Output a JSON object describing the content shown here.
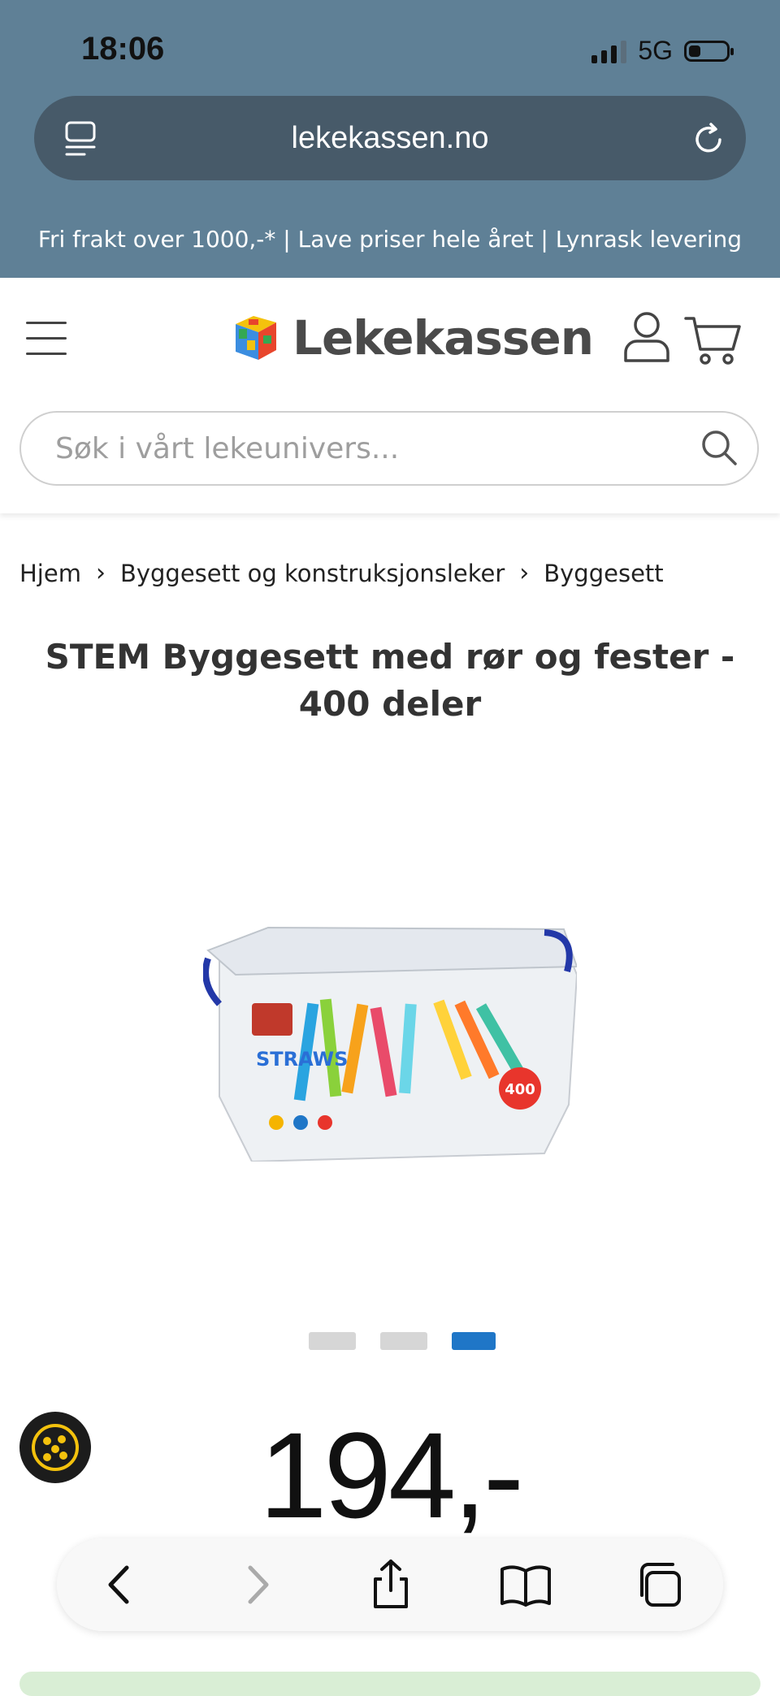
{
  "status_bar": {
    "time": "18:06",
    "network": "5G"
  },
  "browser": {
    "url": "lekekassen.no"
  },
  "promo": {
    "text": "Fri frakt over 1000,-* | Lave priser hele året | Lynrask levering"
  },
  "header": {
    "brand": "Lekekassen",
    "search_placeholder": "Søk i vårt lekeunivers..."
  },
  "breadcrumb": [
    "Hjem",
    "Byggesett og konstruksjonsleker",
    "Byggesett"
  ],
  "product": {
    "title": "STEM Byggesett med rør og fester - 400 deler",
    "box_label": "STRAWS",
    "badge": "400",
    "price": "194,-",
    "image_count": 3,
    "active_image": 3
  },
  "icons": {
    "tabs": "tabs-icon",
    "reload": "reload-icon",
    "menu": "hamburger-icon",
    "user": "user-icon",
    "cart": "cart-icon",
    "search": "search-icon",
    "cookie": "cookie-icon",
    "back": "back-icon",
    "forward": "forward-icon",
    "share": "share-icon",
    "bookmarks": "bookmarks-icon",
    "tab_overview": "tab-overview-icon"
  },
  "colors": {
    "chrome": "#5f8096",
    "urlbar": "#475a69",
    "accent": "#1f76c7"
  }
}
